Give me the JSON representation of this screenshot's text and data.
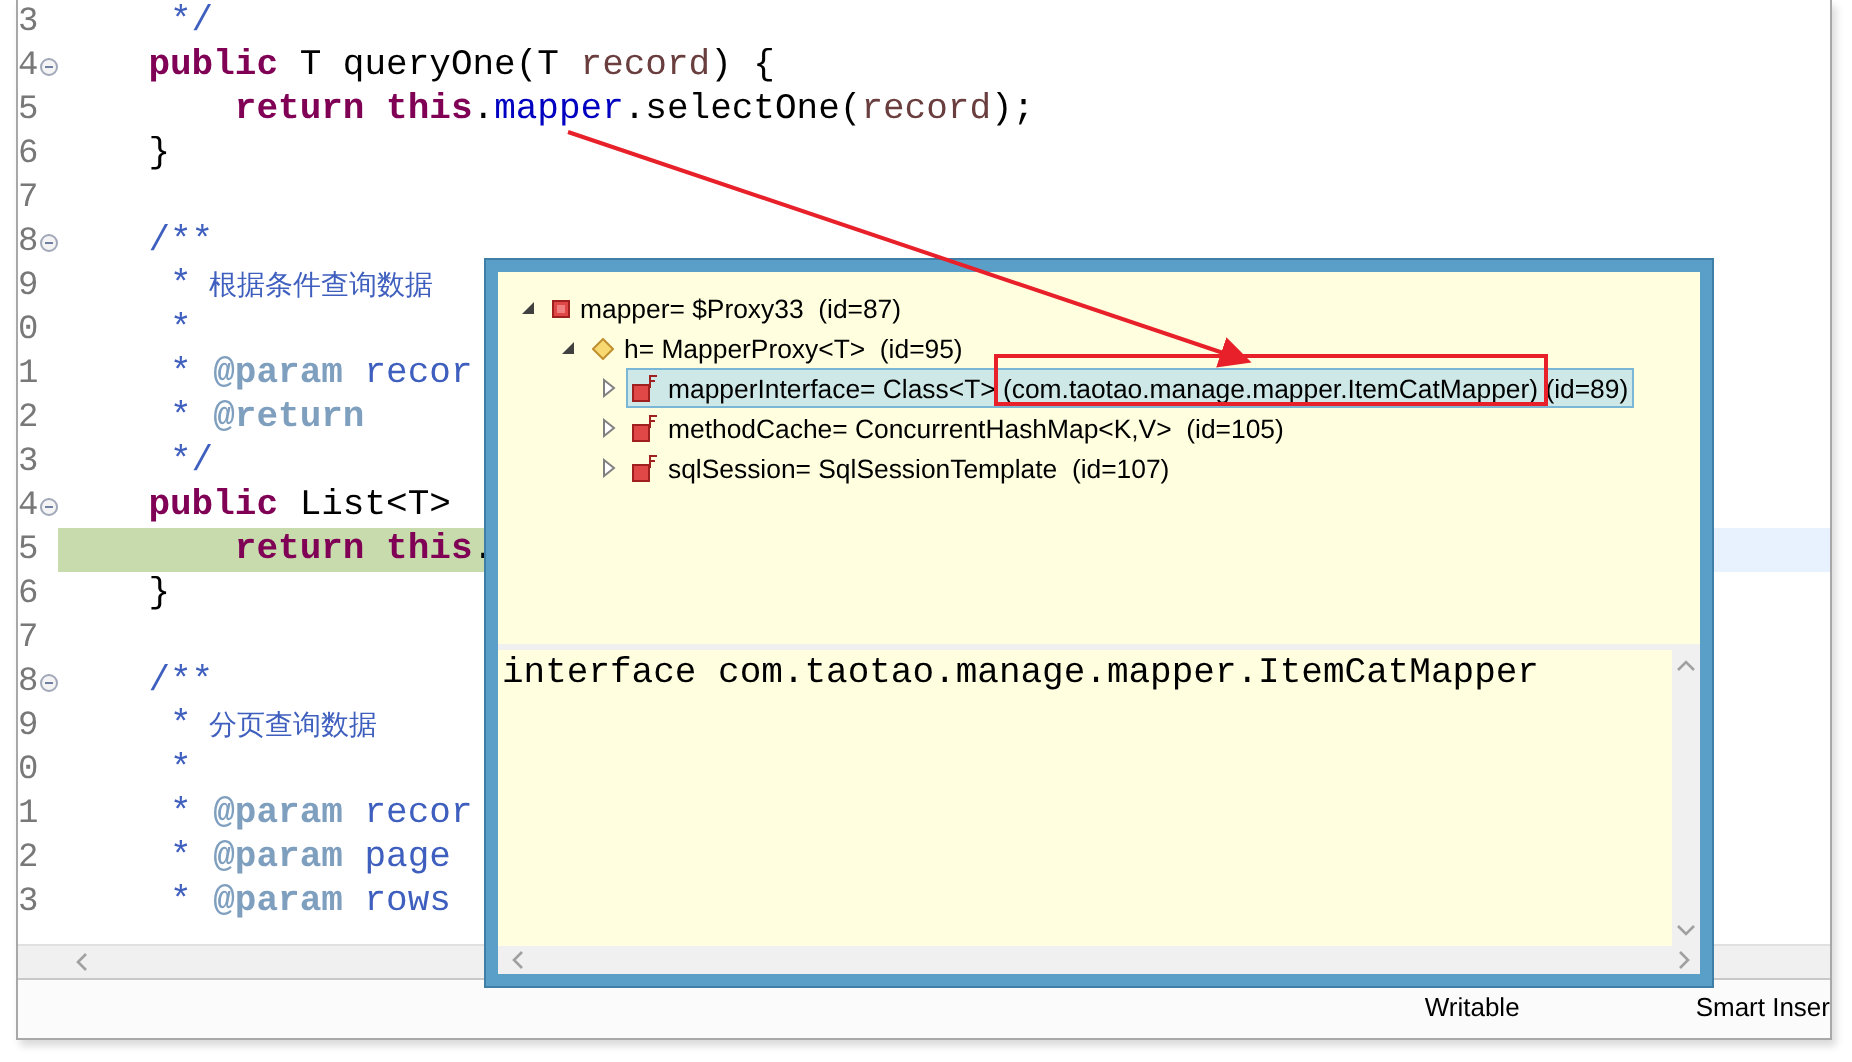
{
  "editor": {
    "lines": [
      {
        "number": "3",
        "fold": false,
        "current": false,
        "tokens": [
          {
            "kind": "comment",
            "text": "     */"
          }
        ]
      },
      {
        "number": "4",
        "fold": true,
        "current": false,
        "tokens": [
          {
            "kind": "keyword",
            "text": "    public"
          },
          {
            "kind": "plain",
            "text": " T queryOne(T "
          },
          {
            "kind": "param",
            "text": "record"
          },
          {
            "kind": "plain",
            "text": ") {"
          }
        ]
      },
      {
        "number": "5",
        "fold": false,
        "current": false,
        "tokens": [
          {
            "kind": "keyword",
            "text": "        return"
          },
          {
            "kind": "keyword",
            "text": " this"
          },
          {
            "kind": "plain",
            "text": "."
          },
          {
            "kind": "field",
            "text": "mapper"
          },
          {
            "kind": "plain",
            "text": ".selectOne("
          },
          {
            "kind": "param",
            "text": "record"
          },
          {
            "kind": "plain",
            "text": ");"
          }
        ]
      },
      {
        "number": "6",
        "fold": false,
        "current": false,
        "tokens": [
          {
            "kind": "plain",
            "text": "    }"
          }
        ]
      },
      {
        "number": "7",
        "fold": false,
        "current": false
      },
      {
        "number": "8",
        "fold": true,
        "current": false,
        "tokens": [
          {
            "kind": "comment",
            "text": "    /**"
          }
        ]
      },
      {
        "number": "9",
        "fold": false,
        "current": false,
        "tokens": [
          {
            "kind": "comment",
            "text": "     *"
          },
          {
            "kind": "doc_text",
            "text": "  根据条件查询数据"
          }
        ]
      },
      {
        "number": "0",
        "fold": false,
        "current": false,
        "tokens": [
          {
            "kind": "comment",
            "text": "     *"
          }
        ]
      },
      {
        "number": "1",
        "fold": false,
        "current": false,
        "tokens": [
          {
            "kind": "comment",
            "text": "     * "
          },
          {
            "kind": "tag",
            "text": "@param"
          },
          {
            "kind": "comment",
            "text": " recor"
          }
        ]
      },
      {
        "number": "2",
        "fold": false,
        "current": false,
        "tokens": [
          {
            "kind": "comment",
            "text": "     * "
          },
          {
            "kind": "tag",
            "text": "@return"
          }
        ]
      },
      {
        "number": "3",
        "fold": false,
        "current": false,
        "tokens": [
          {
            "kind": "comment",
            "text": "     */"
          }
        ]
      },
      {
        "number": "4",
        "fold": true,
        "current": false,
        "tokens": [
          {
            "kind": "keyword",
            "text": "    public"
          },
          {
            "kind": "plain",
            "text": " List<T>"
          }
        ]
      },
      {
        "number": "5",
        "fold": false,
        "current": true,
        "tokens": [
          {
            "kind": "keyword",
            "text": "        return"
          },
          {
            "kind": "keyword",
            "text": " this"
          },
          {
            "kind": "plain",
            "text": "."
          }
        ]
      },
      {
        "number": "6",
        "fold": false,
        "current": false,
        "tokens": [
          {
            "kind": "plain",
            "text": "    }"
          }
        ]
      },
      {
        "number": "7",
        "fold": false,
        "current": false
      },
      {
        "number": "8",
        "fold": true,
        "current": false,
        "tokens": [
          {
            "kind": "comment",
            "text": "    /**"
          }
        ]
      },
      {
        "number": "9",
        "fold": false,
        "current": false,
        "tokens": [
          {
            "kind": "comment",
            "text": "     *"
          },
          {
            "kind": "doc_text",
            "text": "  分页查询数据"
          }
        ]
      },
      {
        "number": "0",
        "fold": false,
        "current": false,
        "tokens": [
          {
            "kind": "comment",
            "text": "     *"
          }
        ]
      },
      {
        "number": "1",
        "fold": false,
        "current": false,
        "tokens": [
          {
            "kind": "comment",
            "text": "     * "
          },
          {
            "kind": "tag",
            "text": "@param"
          },
          {
            "kind": "comment",
            "text": " recor"
          }
        ]
      },
      {
        "number": "2",
        "fold": false,
        "current": false,
        "tokens": [
          {
            "kind": "comment",
            "text": "     * "
          },
          {
            "kind": "tag",
            "text": "@param"
          },
          {
            "kind": "comment",
            "text": " page"
          }
        ]
      },
      {
        "number": "3",
        "fold": false,
        "current": false,
        "tokens": [
          {
            "kind": "comment",
            "text": "     * "
          },
          {
            "kind": "tag",
            "text": "@param"
          },
          {
            "kind": "comment",
            "text": " rows"
          }
        ]
      }
    ]
  },
  "status_bar": [
    "Writable",
    "Smart Inser"
  ],
  "popup": {
    "tree": [
      {
        "label": "mapper= $Proxy33  (id=87)",
        "kind": "field",
        "expanded": true,
        "selected": false,
        "children": [
          {
            "label": "h= MapperProxy<T>  (id=95)",
            "kind": "inherited",
            "expanded": true,
            "selected": false,
            "children": [
              {
                "label": "mapperInterface= Class<T> (com.taotao.manage.mapper.ItemCatMapper) (id=89)",
                "kind": "final_field",
                "expanded": false,
                "selected": true
              },
              {
                "label": "methodCache= ConcurrentHashMap<K,V>  (id=105)",
                "kind": "final_field",
                "expanded": false,
                "selected": false
              },
              {
                "label": "sqlSession= SqlSessionTemplate  (id=107)",
                "kind": "final_field",
                "expanded": false,
                "selected": false
              }
            ]
          }
        ]
      }
    ],
    "detail": "interface com.taotao.manage.mapper.ItemCatMapper"
  }
}
